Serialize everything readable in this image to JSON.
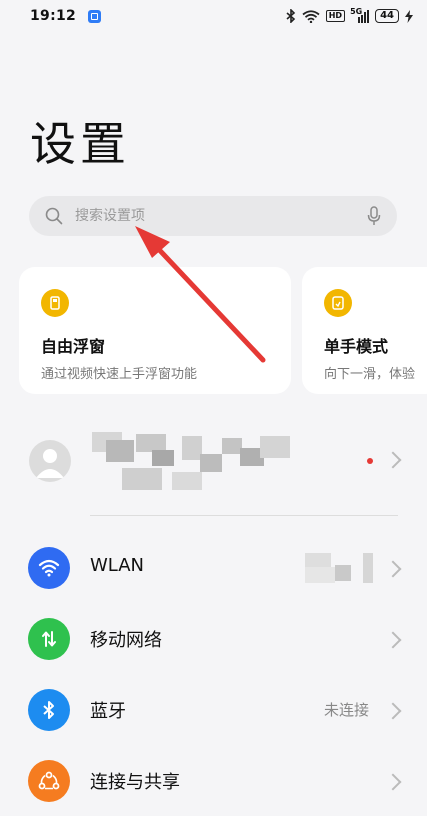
{
  "status_bar": {
    "time": "19:12",
    "hd_label": "HD",
    "network_label": "5G",
    "battery_level": "44"
  },
  "page": {
    "title": "设置"
  },
  "search": {
    "placeholder": "搜索设置项"
  },
  "cards": [
    {
      "title": "自由浮窗",
      "desc": "通过视频快速上手浮窗功能",
      "icon": "floating-window-icon",
      "color": "#f2b600"
    },
    {
      "title": "单手模式",
      "desc": "向下一滑，体验",
      "icon": "one-hand-icon",
      "color": "#f2b600"
    }
  ],
  "profile": {
    "has_notification": true
  },
  "settings_list": [
    {
      "label": "WLAN",
      "value": "",
      "icon": "wifi-icon",
      "color": "#2f6bf2"
    },
    {
      "label": "移动网络",
      "value": "",
      "icon": "mobile-data-icon",
      "color": "#2fc14e"
    },
    {
      "label": "蓝牙",
      "value": "未连接",
      "icon": "bluetooth-icon",
      "color": "#1d8cf0"
    },
    {
      "label": "连接与共享",
      "value": "",
      "icon": "connection-sharing-icon",
      "color": "#f57c20"
    }
  ],
  "colors": {
    "background": "#f5f5f7",
    "annotation_arrow": "#e53935"
  }
}
